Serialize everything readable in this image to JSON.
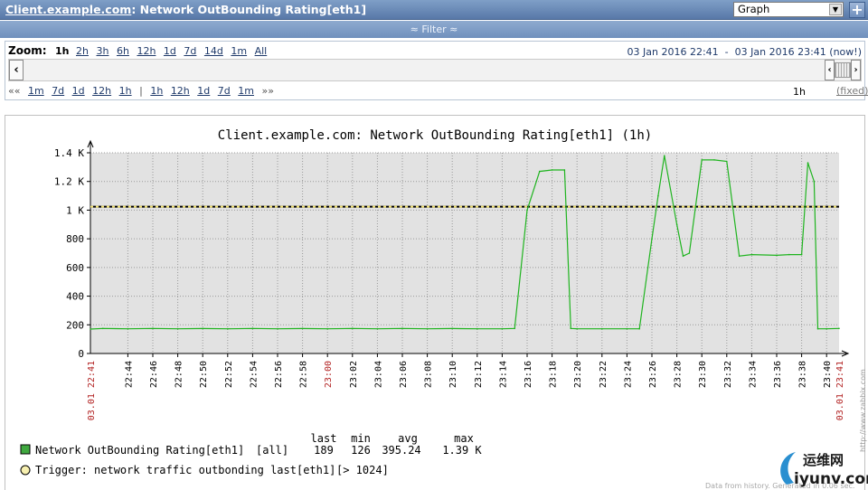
{
  "header": {
    "host_link": "Client.example.com",
    "title_rest": ": Network OutBounding Rating[eth1]",
    "view_select": "Graph",
    "plus_label": "+"
  },
  "filter": {
    "label": "Filter"
  },
  "zoom": {
    "label": "Zoom:",
    "current": "1h",
    "options": [
      "2h",
      "3h",
      "6h",
      "12h",
      "1d",
      "7d",
      "14d",
      "1m",
      "All"
    ],
    "date_from": "03 Jan 2016 22:41",
    "date_sep": "-",
    "date_to": "03 Jan 2016 23:41",
    "date_now": "(now!)"
  },
  "nav": {
    "back_arrows": "««",
    "back": [
      "1m",
      "7d",
      "1d",
      "12h",
      "1h"
    ],
    "separator": "|",
    "forward": [
      "1h",
      "12h",
      "1d",
      "7d",
      "1m"
    ],
    "forward_arrows": "»»",
    "period": "1h",
    "fixed": "(fixed)"
  },
  "chart_data": {
    "type": "line",
    "title": "Client.example.com: Network OutBounding Rating[eth1] (1h)",
    "ylim": [
      0,
      1400
    ],
    "yticks": [
      {
        "v": 0,
        "label": "0"
      },
      {
        "v": 200,
        "label": "200"
      },
      {
        "v": 400,
        "label": "400"
      },
      {
        "v": 600,
        "label": "600"
      },
      {
        "v": 800,
        "label": "800"
      },
      {
        "v": 1000,
        "label": "1 K"
      },
      {
        "v": 1200,
        "label": "1.2 K"
      },
      {
        "v": 1400,
        "label": "1.4 K"
      }
    ],
    "xlim": [
      "22:41",
      "23:41"
    ],
    "x_edge_labels": [
      "03.01 22:41",
      "03.01 23:41"
    ],
    "xticks": [
      "22:44",
      "22:46",
      "22:48",
      "22:50",
      "22:52",
      "22:54",
      "22:56",
      "22:58",
      "23:00",
      "23:02",
      "23:04",
      "23:06",
      "23:08",
      "23:10",
      "23:12",
      "23:14",
      "23:16",
      "23:18",
      "23:20",
      "23:22",
      "23:24",
      "23:26",
      "23:28",
      "23:30",
      "23:32",
      "23:34",
      "23:36",
      "23:38",
      "23:40"
    ],
    "highlight_tick": "23:00",
    "grid": true,
    "trigger_value": 1024,
    "series": [
      {
        "name": "Network OutBounding Rating[eth1]",
        "color": "#1fb41f",
        "points": [
          [
            "22:41",
            170
          ],
          [
            "22:42",
            175
          ],
          [
            "22:44",
            172
          ],
          [
            "22:46",
            175
          ],
          [
            "22:48",
            172
          ],
          [
            "22:50",
            174
          ],
          [
            "22:52",
            172
          ],
          [
            "22:54",
            175
          ],
          [
            "22:56",
            172
          ],
          [
            "22:58",
            174
          ],
          [
            "23:00",
            172
          ],
          [
            "23:02",
            175
          ],
          [
            "23:04",
            172
          ],
          [
            "23:06",
            175
          ],
          [
            "23:08",
            172
          ],
          [
            "23:10",
            174
          ],
          [
            "23:12",
            172
          ],
          [
            "23:14",
            172
          ],
          [
            "23:15",
            175
          ],
          [
            "23:16",
            1000
          ],
          [
            "23:17",
            1270
          ],
          [
            "23:18",
            1280
          ],
          [
            "23:19",
            1280
          ],
          [
            "23:19.5",
            175
          ],
          [
            "23:20",
            172
          ],
          [
            "23:22",
            172
          ],
          [
            "23:24",
            172
          ],
          [
            "23:25",
            172
          ],
          [
            "23:26",
            800
          ],
          [
            "23:26.5",
            1100
          ],
          [
            "23:27",
            1380
          ],
          [
            "23:28",
            900
          ],
          [
            "23:28.5",
            680
          ],
          [
            "23:29",
            700
          ],
          [
            "23:30",
            1350
          ],
          [
            "23:31",
            1350
          ],
          [
            "23:32",
            1340
          ],
          [
            "23:33",
            680
          ],
          [
            "23:34",
            690
          ],
          [
            "23:36",
            685
          ],
          [
            "23:37",
            690
          ],
          [
            "23:38",
            690
          ],
          [
            "23:38.5",
            1330
          ],
          [
            "23:39",
            1200
          ],
          [
            "23:39.3",
            172
          ],
          [
            "23:40",
            172
          ],
          [
            "23:41",
            175
          ]
        ]
      }
    ],
    "legend": {
      "header": [
        "last",
        "min",
        "avg",
        "max"
      ],
      "series_name": "Network OutBounding Rating[eth1]",
      "series_func": "[all]",
      "last": "189",
      "min": "126",
      "avg": "395.24",
      "max": "1.39 K",
      "trigger": "Trigger: network traffic outbonding last[eth1]",
      "trigger_cond": "[> 1024]",
      "series_color": "#3fa83f",
      "trigger_color": "#f7f0b0"
    },
    "side_watermark": "http://www.zabbix.com",
    "footnote": "Data from history. Generated in 0.06 sec."
  },
  "watermark": {
    "text": "运维网",
    "url": "iyunv.com"
  }
}
